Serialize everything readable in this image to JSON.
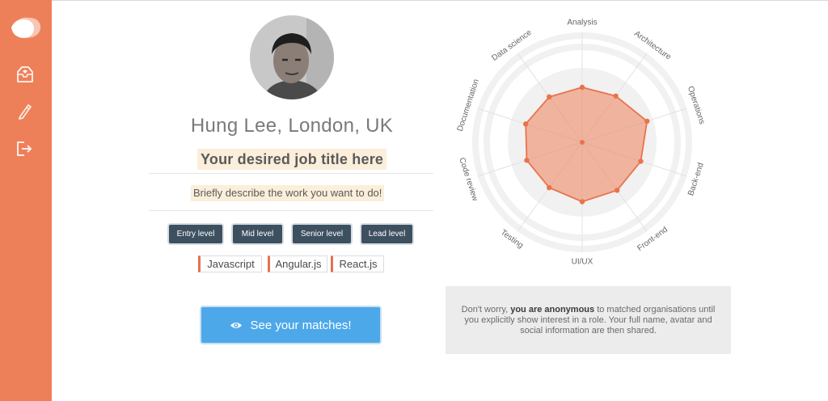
{
  "sidebar": {
    "nav": [
      {
        "icon": "inbox-icon"
      },
      {
        "icon": "pencil-icon"
      },
      {
        "icon": "logout-icon"
      }
    ]
  },
  "profile": {
    "name": "Hung Lee, London, UK",
    "job_title": "Your desired job title here",
    "description": "Briefly describe the work you want to do!"
  },
  "levels": [
    "Entry level",
    "Mid level",
    "Senior level",
    "Lead level"
  ],
  "skills": [
    "Javascript",
    "Angular.js",
    "React.js"
  ],
  "cta": {
    "label": "See your matches!",
    "icon": "eye-icon"
  },
  "notice": {
    "pre": "Don't worry, ",
    "strong": "you are anonymous",
    "post": " to matched organisations until you explicitly show interest in a role. Your full name, avatar and social information are then shared."
  },
  "colors": {
    "sidebar": "#ee8059",
    "accent": "#e57150",
    "level_button": "#3d5060",
    "cta": "#4da8ea"
  },
  "chart_data": {
    "type": "radar",
    "axes": [
      "Analysis",
      "Architecture",
      "Operations",
      "Back-end",
      "Front-end",
      "UI/UX",
      "Testing",
      "Code review",
      "Documentation",
      "Data science"
    ],
    "range": [
      0,
      1
    ],
    "values": [
      0.5,
      0.52,
      0.62,
      0.56,
      0.54,
      0.54,
      0.51,
      0.53,
      0.54,
      0.51
    ],
    "grid": true
  }
}
